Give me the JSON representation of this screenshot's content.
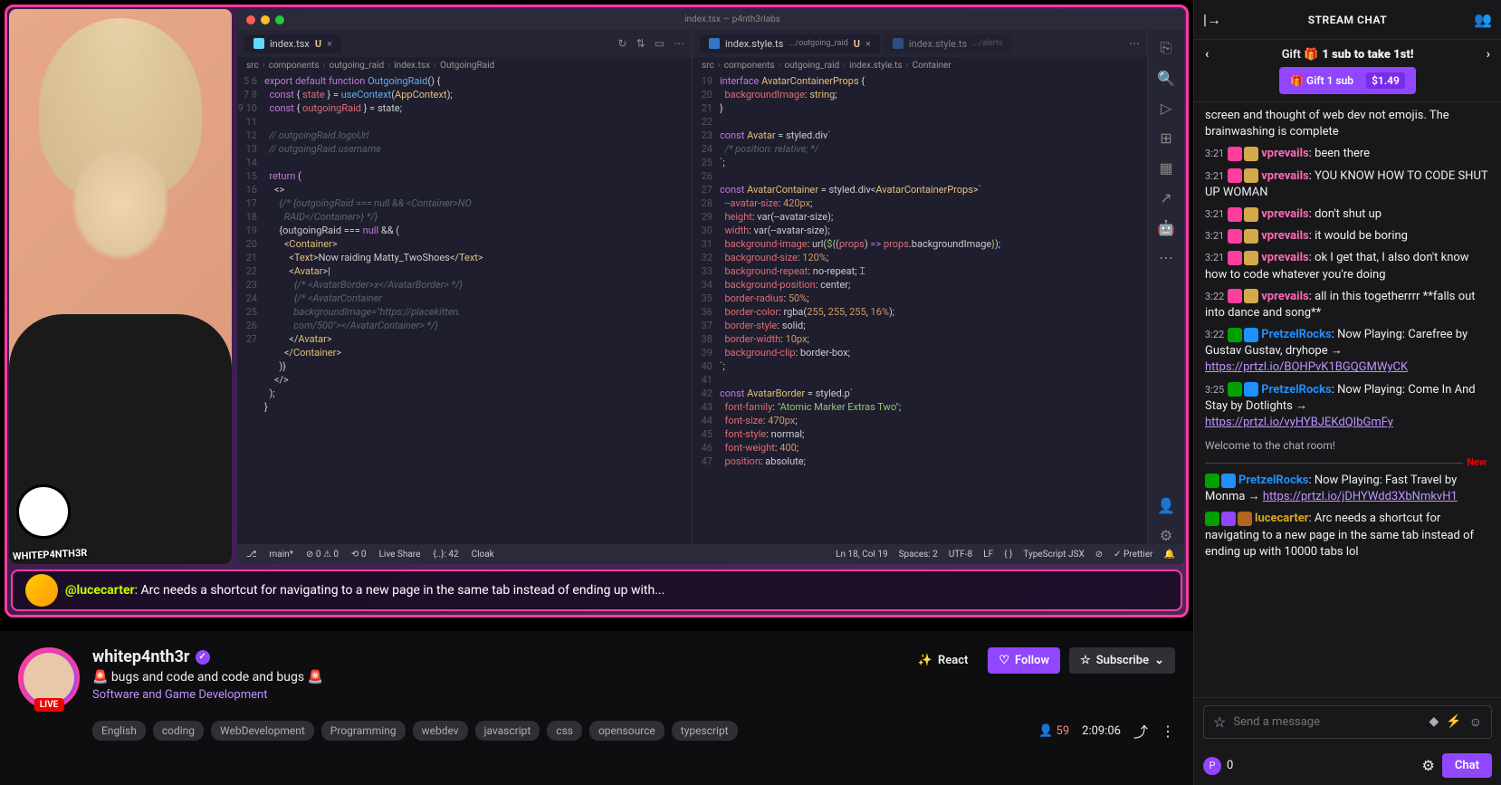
{
  "header": {
    "collapse_icon": "|→",
    "title": "STREAM CHAT",
    "community_icon": "👥"
  },
  "gift": {
    "left_arrow": "‹",
    "right_arrow": "›",
    "title_prefix": "Gift 🎁",
    "title_bold": "1 sub to take 1st!",
    "button_label": "🎁 Gift 1 sub",
    "price": "$1.49"
  },
  "messages": [
    {
      "time": "",
      "user": "",
      "color": "",
      "badges": [],
      "text": "screen and thought of web dev not emojis. The brainwashing is complete",
      "link": ""
    },
    {
      "time": "3:21",
      "user": "vprevails",
      "color": "#ff69b4",
      "badges": [
        "#ff3e9e",
        "#d4a94a"
      ],
      "text": ": been there",
      "link": ""
    },
    {
      "time": "3:21",
      "user": "vprevails",
      "color": "#ff69b4",
      "badges": [
        "#ff3e9e",
        "#d4a94a"
      ],
      "text": ": YOU KNOW HOW TO CODE SHUT UP WOMAN",
      "link": ""
    },
    {
      "time": "3:21",
      "user": "vprevails",
      "color": "#ff69b4",
      "badges": [
        "#ff3e9e",
        "#d4a94a"
      ],
      "text": ": don't shut up",
      "link": ""
    },
    {
      "time": "3:21",
      "user": "vprevails",
      "color": "#ff69b4",
      "badges": [
        "#ff3e9e",
        "#d4a94a"
      ],
      "text": ": it would be boring",
      "link": ""
    },
    {
      "time": "3:21",
      "user": "vprevails",
      "color": "#ff69b4",
      "badges": [
        "#ff3e9e",
        "#d4a94a"
      ],
      "text": ": ok I get that, I also don't know how to code whatever you're doing",
      "link": ""
    },
    {
      "time": "3:22",
      "user": "vprevails",
      "color": "#ff69b4",
      "badges": [
        "#ff3e9e",
        "#d4a94a"
      ],
      "text": ": all in this togetherrrr **falls out into dance and song**",
      "link": ""
    },
    {
      "time": "3:22",
      "user": "PretzelRocks",
      "color": "#1e90ff",
      "badges": [
        "#00a000",
        "#1e90ff"
      ],
      "text": ": Now Playing: Carefree by Gustav Gustav, dryhope → ",
      "link": "https://prtzl.io/BOHPvK1BGQGMWyCK"
    },
    {
      "time": "3:25",
      "user": "PretzelRocks",
      "color": "#1e90ff",
      "badges": [
        "#00a000",
        "#1e90ff"
      ],
      "text": ": Now Playing: Come In And Stay by Dotlights → ",
      "link": "https://prtzl.io/vyHYBJEKdQIbGmFy"
    }
  ],
  "welcome": "Welcome to the chat room!",
  "divider_label": "New",
  "new_messages": [
    {
      "time": "",
      "user": "PretzelRocks",
      "color": "#1e90ff",
      "badges": [
        "#00a000",
        "#1e90ff"
      ],
      "text": ": Now Playing: Fast Travel by Monma → ",
      "link": "https://prtzl.io/jDHYWdd3XbNmkvH1"
    },
    {
      "time": "",
      "user": "lucecarter",
      "color": "#daa520",
      "badges": [
        "#00a000",
        "#9146ff",
        "#b5651d"
      ],
      "text": ": Arc needs a shortcut for navigating to a new page in the same tab instead of ending up with 10000 tabs lol",
      "link": ""
    }
  ],
  "input": {
    "placeholder": "Send a message"
  },
  "points": {
    "value": "0"
  },
  "chat_button": "Chat",
  "channel": {
    "name": "whitep4nth3r",
    "title": "🚨 bugs and code and code and bugs 🚨",
    "category": "Software and Game Development",
    "viewers": "59",
    "uptime": "2:09:06",
    "follow": "Follow",
    "subscribe": "Subscribe",
    "react": "React",
    "tags": [
      "English",
      "coding",
      "WebDevelopment",
      "Programming",
      "webdev",
      "javascript",
      "css",
      "opensource",
      "typescript"
    ]
  },
  "featured": {
    "user": "@lucecarter",
    "text": ": Arc needs a shortcut for navigating to a new page in the same tab instead of ending up with..."
  },
  "vscode": {
    "window_title": "index.tsx — p4nth3rlabs",
    "left": {
      "tab": "index.tsx",
      "tab_status": "U",
      "crumbs": [
        "src",
        "components",
        "outgoing_raid",
        "index.tsx",
        "OutgoingRaid"
      ],
      "lines_start": 5,
      "code": [
        {
          "n": 5,
          "html": "<span class='kw'>export default function</span> <span class='fn'>OutgoingRaid</span>() {"
        },
        {
          "n": 6,
          "html": "  <span class='kw'>const</span> { <span class='pr'>state</span> } = <span class='fn'>useContext</span>(<span class='type'>AppContext</span>);"
        },
        {
          "n": 7,
          "html": "  <span class='kw'>const</span> { <span class='pr'>outgoingRaid</span> } = state;"
        },
        {
          "n": 8,
          "html": ""
        },
        {
          "n": 9,
          "html": "  <span class='cmt'>// outgoingRaid.logoUrl</span>"
        },
        {
          "n": 10,
          "html": "  <span class='cmt'>// outgoingRaid.username</span>"
        },
        {
          "n": 11,
          "html": ""
        },
        {
          "n": 12,
          "html": "  <span class='kw'>return</span> ("
        },
        {
          "n": 13,
          "html": "    &lt;&gt;"
        },
        {
          "n": 14,
          "html": "      <span class='cmt'>{/* {outgoingRaid === null && &lt;Container&gt;NO\n        RAID&lt;/Container&gt;} */}</span>"
        },
        {
          "n": 15,
          "html": "      {outgoingRaid === <span class='kw'>null</span> &amp;&amp; ("
        },
        {
          "n": 16,
          "html": "        &lt;<span class='type'>Container</span>&gt;"
        },
        {
          "n": 17,
          "html": "          &lt;<span class='type'>Text</span>&gt;Now raiding Matty_TwoShoes&lt;/<span class='type'>Text</span>&gt;"
        },
        {
          "n": 18,
          "html": "          &lt;<span class='type'>Avatar</span>&gt;|"
        },
        {
          "n": 19,
          "html": "            <span class='cmt'>{/* &lt;AvatarBorder&gt;x&lt;/AvatarBorder&gt; */}</span>"
        },
        {
          "n": 20,
          "html": "            <span class='cmt'>{/* &lt;AvatarContainer\n            backgroundImage=\"https://placekitten.\n            com/500\"&gt;&lt;/AvatarContainer&gt; */}</span>"
        },
        {
          "n": 21,
          "html": "          &lt;/<span class='type'>Avatar</span>&gt;"
        },
        {
          "n": 22,
          "html": "        &lt;/<span class='type'>Container</span>&gt;"
        },
        {
          "n": 23,
          "html": "      )}"
        },
        {
          "n": 24,
          "html": "    &lt;/&gt;"
        },
        {
          "n": 25,
          "html": "  );"
        },
        {
          "n": 26,
          "html": "}"
        },
        {
          "n": 27,
          "html": ""
        }
      ]
    },
    "right": {
      "tab": "index.style.ts",
      "tab_path": ".../outgoing_raid",
      "tab_status": "U",
      "tab2": "index.style.ts",
      "tab2_path": ".../alerts",
      "crumbs": [
        "src",
        "components",
        "outgoing_raid",
        "index.style.ts",
        "Container"
      ],
      "code": [
        {
          "n": 19,
          "html": "<span class='kw'>interface</span> <span class='type'>AvatarContainerProps</span> {"
        },
        {
          "n": 20,
          "html": "  <span class='pr'>backgroundImage</span>: <span class='type'>string</span>;"
        },
        {
          "n": 21,
          "html": "}"
        },
        {
          "n": 22,
          "html": ""
        },
        {
          "n": 23,
          "html": "<span class='kw'>const</span> <span class='type'>Avatar</span> = styled.div<span class='str'>`</span>"
        },
        {
          "n": 24,
          "html": "  <span class='cmt'>/* position: relative; */</span>"
        },
        {
          "n": 25,
          "html": "<span class='str'>`</span>;"
        },
        {
          "n": 26,
          "html": ""
        },
        {
          "n": 27,
          "html": "<span class='kw'>const</span> <span class='type'>AvatarContainer</span> = styled.div&lt;<span class='type'>AvatarContainerProps</span>&gt;<span class='str'>`</span>"
        },
        {
          "n": 28,
          "html": "  <span class='pr'>--avatar-size</span>: <span class='num'>420px</span>;"
        },
        {
          "n": 29,
          "html": "  <span class='pr'>height</span>: var(--avatar-size);"
        },
        {
          "n": 30,
          "html": "  <span class='pr'>width</span>: var(--avatar-size);"
        },
        {
          "n": 31,
          "html": "  <span class='pr'>background-image</span>: url(<span class='str'>${</span>(<span class='pr'>props</span>) <span class='kw'>=&gt;</span> <span class='pr'>props</span>.backgroundImage<span class='str'>}</span>);"
        },
        {
          "n": 32,
          "html": "  <span class='pr'>background-size</span>: <span class='num'>120%</span>;"
        },
        {
          "n": 33,
          "html": "  <span class='pr'>background-repeat</span>: no-repeat; <span style='color:#fff'>⌶</span>"
        },
        {
          "n": 34,
          "html": "  <span class='pr'>background-position</span>: center;"
        },
        {
          "n": 35,
          "html": "  <span class='pr'>border-radius</span>: <span class='num'>50%</span>;"
        },
        {
          "n": 36,
          "html": "  <span class='pr'>border-color</span>: rgba(<span class='num'>255</span>, <span class='num'>255</span>, <span class='num'>255</span>, <span class='num'>16%</span>);"
        },
        {
          "n": 37,
          "html": "  <span class='pr'>border-style</span>: solid;"
        },
        {
          "n": 38,
          "html": "  <span class='pr'>border-width</span>: <span class='num'>10px</span>;"
        },
        {
          "n": 39,
          "html": "  <span class='pr'>background-clip</span>: border-box;"
        },
        {
          "n": 40,
          "html": "<span class='str'>`</span>;"
        },
        {
          "n": 41,
          "html": ""
        },
        {
          "n": 42,
          "html": "<span class='kw'>const</span> <span class='type'>AvatarBorder</span> = styled.p<span class='str'>`</span>"
        },
        {
          "n": 43,
          "html": "  <span class='pr'>font-family</span>: <span class='str'>\"Atomic Marker Extras Two\"</span>;"
        },
        {
          "n": 44,
          "html": "  <span class='pr'>font-size</span>: <span class='num'>470px</span>;"
        },
        {
          "n": 45,
          "html": "  <span class='pr'>font-style</span>: normal;"
        },
        {
          "n": 46,
          "html": "  <span class='pr'>font-weight</span>: <span class='num'>400</span>;"
        },
        {
          "n": 47,
          "html": "  <span class='pr'>position</span>: absolute;"
        }
      ]
    },
    "status": {
      "branch": "main*",
      "errors": "⊘ 0 ⚠ 0",
      "ports": "⟲ 0",
      "liveshare": "Live Share",
      "braces": "{..}: 42",
      "cloak": "Cloak",
      "cursor": "Ln 18, Col 19",
      "spaces": "Spaces: 2",
      "encoding": "UTF-8",
      "eol": "LF",
      "lang": "TypeScript JSX",
      "prettier": "✓ Prettier"
    }
  },
  "webcam_name": "WHITEP4NTH3R"
}
